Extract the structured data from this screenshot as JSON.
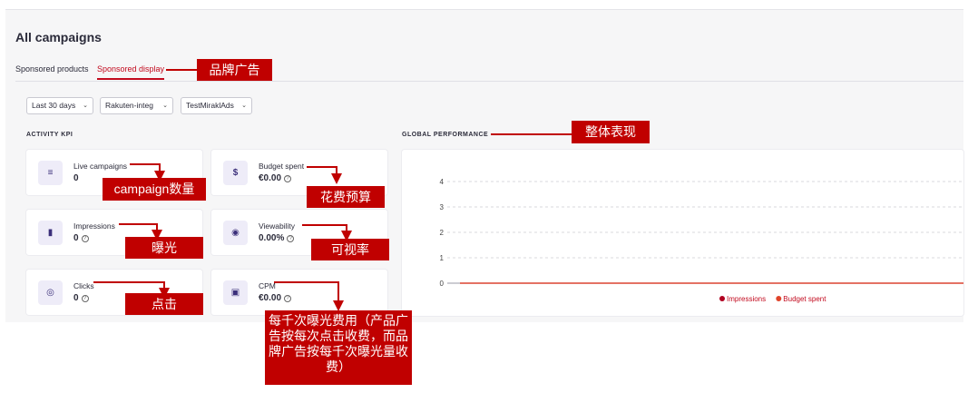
{
  "page": {
    "title": "All campaigns",
    "tabs": [
      {
        "label": "Sponsored products"
      },
      {
        "label": "Sponsored display"
      }
    ]
  },
  "filters": [
    {
      "label": "Last 30 days"
    },
    {
      "label": "Rakuten-integ"
    },
    {
      "label": "TestMiraklAds"
    }
  ],
  "kpi": {
    "section_label": "ACTIVITY KPI",
    "cards": [
      {
        "label": "Live campaigns",
        "value": "0",
        "icon": "sliders-icon"
      },
      {
        "label": "Budget spent",
        "value": "€0.00",
        "icon": "dollar-coin-icon"
      },
      {
        "label": "Impressions",
        "value": "0",
        "icon": "bar-chart-icon"
      },
      {
        "label": "Viewability",
        "value": "0.00%",
        "icon": "eye-icon"
      },
      {
        "label": "Clicks",
        "value": "0",
        "icon": "click-cursor-icon"
      },
      {
        "label": "CPM",
        "value": "€0.00",
        "icon": "briefcase-icon"
      }
    ]
  },
  "performance": {
    "section_label": "GLOBAL PERFORMANCE"
  },
  "chart_data": {
    "type": "line",
    "title": "",
    "xlabel": "",
    "ylabel": "",
    "ylim": [
      0,
      4
    ],
    "y_ticks": [
      "4",
      "3",
      "2",
      "1",
      "0"
    ],
    "series": [
      {
        "name": "Impressions",
        "color": "#b00020",
        "values": [
          0,
          0
        ]
      },
      {
        "name": "Budget spent",
        "color": "#e0442a",
        "values": [
          0,
          0
        ]
      }
    ],
    "grid": true,
    "legend_position": "bottom-center"
  },
  "annotations": {
    "sponsored_display": "品牌广告",
    "global_performance": "整体表现",
    "live_campaigns": "campaign数量",
    "budget_spent": "花费预算",
    "impressions": "曝光",
    "viewability": "可视率",
    "clicks": "点击",
    "cpm": "每千次曝光费用（产品广告按每次点击收费，而品牌广告按每千次曝光量收费）"
  },
  "colors": {
    "accent": "#c20a1e",
    "annotation": "#c00000",
    "icon_bg": "#eeecf8"
  }
}
